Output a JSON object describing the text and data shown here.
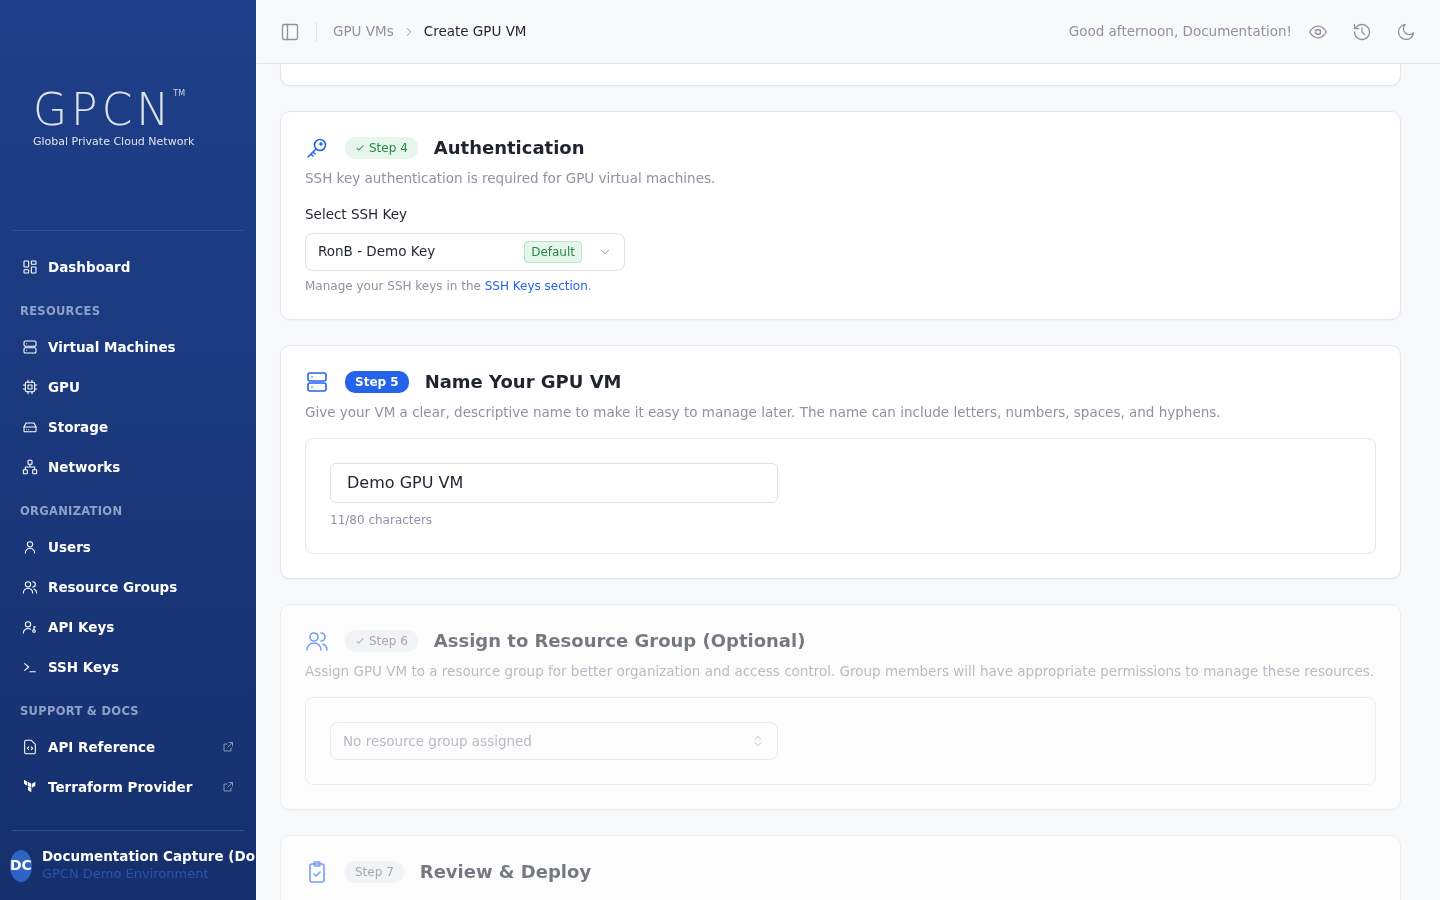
{
  "sidebar": {
    "logo": {
      "mark": "GPCN",
      "trademark": "TM",
      "tagline": "Global Private Cloud Network"
    },
    "groups": [
      {
        "items": [
          {
            "label": "Dashboard",
            "external": false
          }
        ]
      },
      {
        "heading": "RESOURCES",
        "items": [
          {
            "label": "Virtual Machines",
            "external": false
          },
          {
            "label": "GPU",
            "external": false
          },
          {
            "label": "Storage",
            "external": false
          },
          {
            "label": "Networks",
            "external": false
          }
        ]
      },
      {
        "heading": "ORGANIZATION",
        "items": [
          {
            "label": "Users",
            "external": false
          },
          {
            "label": "Resource Groups",
            "external": false
          },
          {
            "label": "API Keys",
            "external": false
          },
          {
            "label": "SSH Keys",
            "external": false
          }
        ]
      },
      {
        "heading": "SUPPORT & DOCS",
        "items": [
          {
            "label": "API Reference",
            "external": true
          },
          {
            "label": "Terraform Provider",
            "external": true
          }
        ]
      }
    ],
    "account": {
      "initials": "DC",
      "name": "Documentation Capture (Do",
      "environment": "GPCN Demo Environment"
    }
  },
  "header": {
    "breadcrumbs": [
      {
        "label": "GPU VMs",
        "current": false
      },
      {
        "label": "Create GPU VM",
        "current": true
      }
    ],
    "greeting": "Good afternoon, Documentation!"
  },
  "steps": [
    {
      "badge": "Step 4",
      "checked": true,
      "disabled": false,
      "title": "Authentication",
      "description": "SSH key authentication is required for GPU virtual machines.",
      "kind": "ssh",
      "field_label": "Select SSH Key",
      "value": "RonB - Demo Key",
      "tag": "Default",
      "help": "Manage your SSH keys in the ",
      "help_link": "SSH Keys section",
      "help_end": "."
    },
    {
      "badge": "Step 5",
      "checked": false,
      "disabled": false,
      "title": "Name Your GPU VM",
      "description": "Give your VM a clear, descriptive name to make it easy to manage later. The name can include letters, numbers, spaces, and hyphens.",
      "kind": "name",
      "value": "Demo GPU VM",
      "counter": "11/80 characters"
    },
    {
      "badge": "Step 6",
      "checked": true,
      "disabled": true,
      "title": "Assign to Resource Group (Optional)",
      "description": "Assign GPU VM to a resource group for better organization and access control. Group members will have appropriate permissions to manage these resources.",
      "kind": "group",
      "placeholder": "No resource group assigned"
    },
    {
      "badge": "Step 7",
      "checked": false,
      "disabled": true,
      "title": "Review & Deploy",
      "kind": "review"
    }
  ]
}
